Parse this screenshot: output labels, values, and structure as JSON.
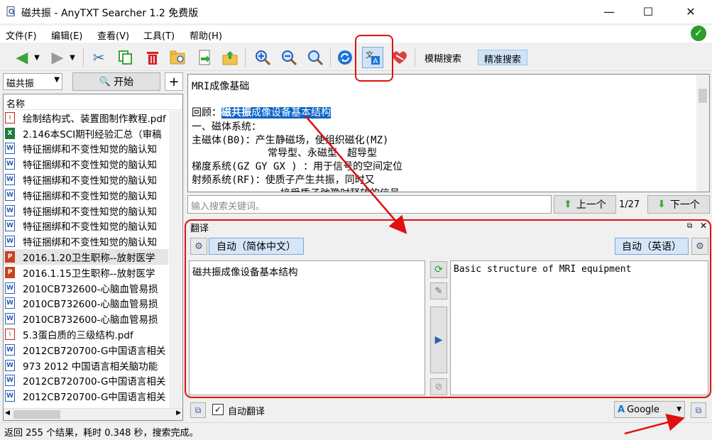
{
  "window": {
    "title": "磁共振 - AnyTXT Searcher 1.2 免费版",
    "minimize": "—",
    "maximize": "☐",
    "close": "✕"
  },
  "menu": [
    "文件(F)",
    "编辑(E)",
    "查看(V)",
    "工具(T)",
    "帮助(H)"
  ],
  "toolbar": {
    "fuzzy_search": "模糊搜索",
    "exact_search": "精准搜索"
  },
  "search": {
    "query": "磁共振",
    "start_label": "开始",
    "plus_label": "+"
  },
  "file_list": {
    "header": "名称",
    "items": [
      {
        "name": "绘制结构式、装置图制作教程.pdf",
        "type": "pdf"
      },
      {
        "name": "2.146本SCI期刊经验汇总（审稿",
        "type": "xls"
      },
      {
        "name": "特征捆绑和不变性知觉的脑认知",
        "type": "doc"
      },
      {
        "name": "特征捆绑和不变性知觉的脑认知",
        "type": "doc"
      },
      {
        "name": "特征捆绑和不变性知觉的脑认知",
        "type": "doc"
      },
      {
        "name": "特征捆绑和不变性知觉的脑认知",
        "type": "doc"
      },
      {
        "name": "特征捆绑和不变性知觉的脑认知",
        "type": "doc"
      },
      {
        "name": "特征捆绑和不变性知觉的脑认知",
        "type": "doc"
      },
      {
        "name": "特征捆绑和不变性知觉的脑认知",
        "type": "doc"
      },
      {
        "name": "2016.1.20卫生职称--放射医学",
        "type": "ppt",
        "selected": true
      },
      {
        "name": "2016.1.15卫生职称--放射医学",
        "type": "ppt"
      },
      {
        "name": "2010CB732600-心脑血管易损",
        "type": "doc"
      },
      {
        "name": "2010CB732600-心脑血管易损",
        "type": "doc"
      },
      {
        "name": "2010CB732600-心脑血管易损",
        "type": "doc"
      },
      {
        "name": "5.3蛋白质的三级结构.pdf",
        "type": "pdf"
      },
      {
        "name": "2012CB720700-G中国语言相关",
        "type": "doc"
      },
      {
        "name": "973 2012 中国语言相关脑功能",
        "type": "doc"
      },
      {
        "name": "2012CB720700-G中国语言相关",
        "type": "doc"
      },
      {
        "name": "2012CB720700-G中国语言相关",
        "type": "doc"
      }
    ]
  },
  "document": {
    "line1": "MRI成像基础",
    "line2_prefix": "回顾：",
    "line2_hl_bold": "磁共振",
    "line2_hl_rest": "成像设备基本结构",
    "line3": "一、磁体系统：",
    "line4": "主磁体(B0)：产生静磁场，使组织磁化(MZ)",
    "line5": "常导型、永磁型、超导型",
    "line6": "梯度系统(GZ GY GX ) ：用于信号的空间定位",
    "line7": "射频系统(RF)：使质子产生共振，同时又",
    "line8": "接受质子弛豫时释放的信号"
  },
  "keyword_search": {
    "placeholder": "输入搜索关键词。",
    "prev_label": "上一个",
    "next_label": "下一个",
    "pager": "1/27"
  },
  "translation": {
    "panel_title": "翻译",
    "source_lang": "自动（简体中文）",
    "target_lang": "自动（英语）",
    "source_text": "磁共振成像设备基本结构",
    "target_text": "Basic structure of MRI equipment",
    "auto_translate_label": "自动翻译",
    "engine": "Google"
  },
  "status": {
    "text": "返回 255 个结果，耗时 0.348 秒，搜索完成。"
  },
  "colors": {
    "accent_red": "#e01010",
    "highlight": "#0a64c8",
    "lang_button": "#d6e6f7",
    "ok_green": "#2a9d2a"
  }
}
